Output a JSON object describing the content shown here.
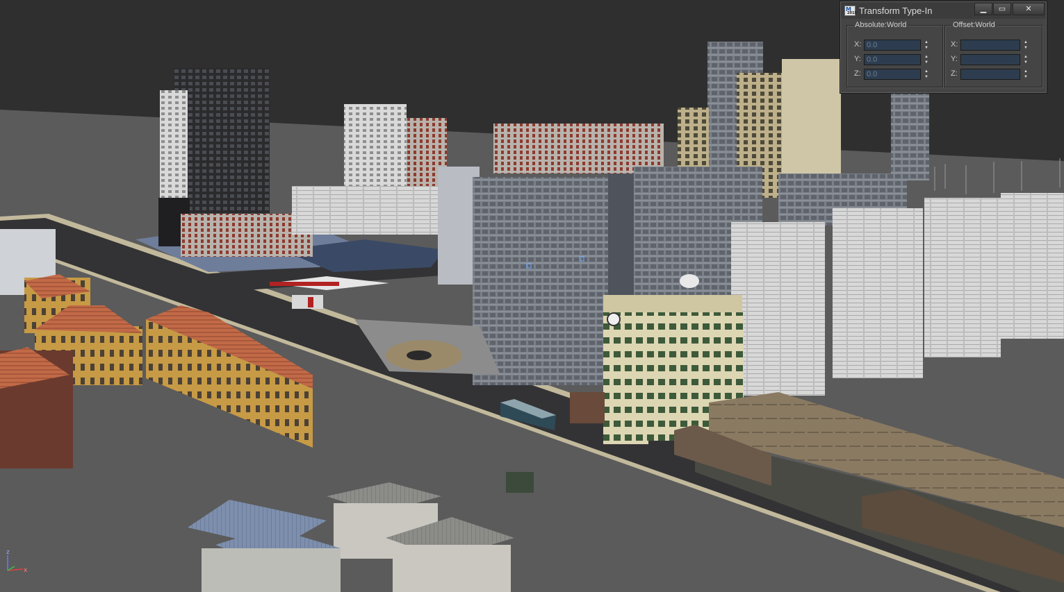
{
  "dialog": {
    "title": "Transform Type-In",
    "app_icon": "3ds-max-icon",
    "window_buttons": [
      "minimize-icon",
      "maximize-icon",
      "close-icon"
    ],
    "absolute": {
      "label": "Absolute:World",
      "x_label": "X:",
      "y_label": "Y:",
      "z_label": "Z:",
      "x": "0.0",
      "y": "0.0",
      "z": "0.0"
    },
    "offset": {
      "label": "Offset:World",
      "x_label": "X:",
      "y_label": "Y:",
      "z_label": "Z:",
      "x": "",
      "y": "",
      "z": ""
    }
  },
  "viewport": {
    "scene": "3D city model perspective view",
    "background_color": "#2f2f2f",
    "ground_color": "#5b5b5b",
    "road_color": "#333335"
  },
  "axis_tripod": {
    "z": "z",
    "x": "x"
  }
}
